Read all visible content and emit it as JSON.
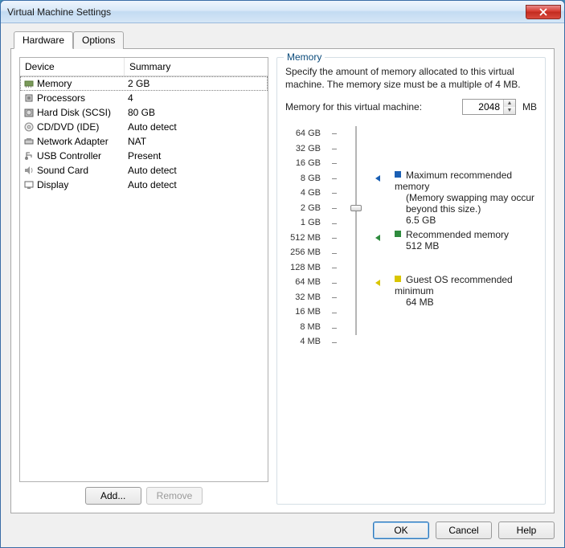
{
  "window": {
    "title": "Virtual Machine Settings"
  },
  "tabs": {
    "hardware": "Hardware",
    "options": "Options"
  },
  "headers": {
    "device": "Device",
    "summary": "Summary"
  },
  "devices": [
    {
      "name": "Memory",
      "summary": "2 GB",
      "icon": "memory"
    },
    {
      "name": "Processors",
      "summary": "4",
      "icon": "cpu"
    },
    {
      "name": "Hard Disk (SCSI)",
      "summary": "80 GB",
      "icon": "disk"
    },
    {
      "name": "CD/DVD (IDE)",
      "summary": "Auto detect",
      "icon": "cd"
    },
    {
      "name": "Network Adapter",
      "summary": "NAT",
      "icon": "net"
    },
    {
      "name": "USB Controller",
      "summary": "Present",
      "icon": "usb"
    },
    {
      "name": "Sound Card",
      "summary": "Auto detect",
      "icon": "sound"
    },
    {
      "name": "Display",
      "summary": "Auto detect",
      "icon": "display"
    }
  ],
  "buttons": {
    "add": "Add...",
    "remove": "Remove",
    "ok": "OK",
    "cancel": "Cancel",
    "help": "Help"
  },
  "memory": {
    "groupTitle": "Memory",
    "desc": "Specify the amount of memory allocated to this virtual machine. The memory size must be a multiple of 4 MB.",
    "label": "Memory for this virtual machine:",
    "value": "2048",
    "unit": "MB",
    "ticks": [
      "64 GB",
      "32 GB",
      "16 GB",
      "8 GB",
      "4 GB",
      "2 GB",
      "1 GB",
      "512 MB",
      "256 MB",
      "128 MB",
      "64 MB",
      "32 MB",
      "16 MB",
      "8 MB",
      "4 MB"
    ],
    "legend": {
      "max": {
        "title": "Maximum recommended memory",
        "note": "(Memory swapping may occur beyond this size.)",
        "value": "6.5 GB",
        "color": "#1a5fb4"
      },
      "rec": {
        "title": "Recommended memory",
        "value": "512 MB",
        "color": "#2e8b3d"
      },
      "min": {
        "title": "Guest OS recommended minimum",
        "value": "64 MB",
        "color": "#d9c500"
      }
    }
  }
}
